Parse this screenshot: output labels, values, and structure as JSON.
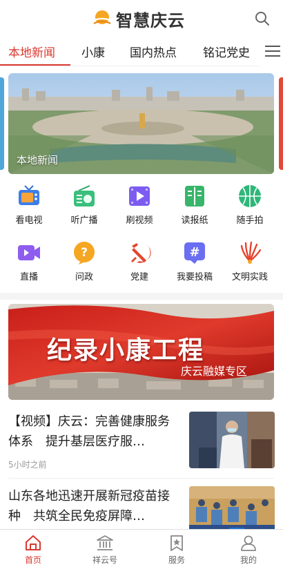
{
  "header": {
    "app_title": "智慧庆云"
  },
  "tabs": [
    {
      "label": "本地新闻",
      "active": true
    },
    {
      "label": "小康"
    },
    {
      "label": "国内热点"
    },
    {
      "label": "铭记党史"
    }
  ],
  "banner": {
    "caption": "本地新闻"
  },
  "grid": [
    {
      "label": "看电视",
      "icon": "tv-icon"
    },
    {
      "label": "听广播",
      "icon": "radio-icon"
    },
    {
      "label": "刷视频",
      "icon": "video-play-icon"
    },
    {
      "label": "读报纸",
      "icon": "newspaper-icon"
    },
    {
      "label": "随手拍",
      "icon": "ball-icon"
    },
    {
      "label": "直播",
      "icon": "camera-icon"
    },
    {
      "label": "问政",
      "icon": "question-icon"
    },
    {
      "label": "党建",
      "icon": "party-emblem-icon"
    },
    {
      "label": "我要投稿",
      "icon": "hashtag-icon"
    },
    {
      "label": "文明实践",
      "icon": "civilization-logo-icon"
    }
  ],
  "promo": {
    "title": "纪录小康工程",
    "subtitle": "庆云融媒专区"
  },
  "news": [
    {
      "title": "【视频】庆云：完善健康服务体系　提升基层医疗服…",
      "time": "5小时之前"
    },
    {
      "title": "山东各地迅速开展新冠疫苗接种　共筑全民免疫屏障…",
      "time": ""
    }
  ],
  "bottom_nav": [
    {
      "label": "首页",
      "active": true
    },
    {
      "label": "祥云号"
    },
    {
      "label": "服务"
    },
    {
      "label": "我的"
    }
  ],
  "colors": {
    "accent": "#d9382e"
  }
}
